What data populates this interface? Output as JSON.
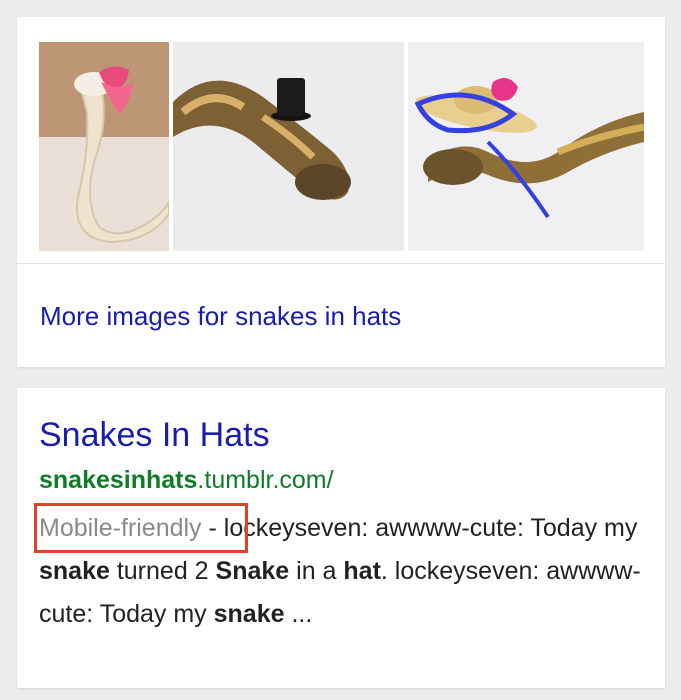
{
  "colors": {
    "link_blue": "#1a1dab",
    "url_green": "#0f7d28",
    "mobile_friendly_gray": "#8a8a8a",
    "highlight_red": "#e0432c"
  },
  "images": {
    "items": [
      {
        "icon": "snake-with-pink-hat-image"
      },
      {
        "icon": "snake-with-top-hat-image"
      },
      {
        "icon": "snake-with-sun-hat-image"
      }
    ],
    "more_link": "More images for snakes in hats"
  },
  "result": {
    "title": "Snakes In Hats",
    "url_bold": "snakesinhats",
    "url_rest": ".tumblr.com/",
    "mobile_friendly": "Mobile-friendly",
    "snippet": {
      "s1": " - lockeyseven: awwww-cute: Today my ",
      "b1": "snake",
      "s2": " turned 2 ",
      "b2": "Snake",
      "s3": " in a ",
      "b3": "hat",
      "s4": ". lockeyseven: awwww-cute: Today my ",
      "b4": "snake",
      "s5": " ..."
    }
  }
}
